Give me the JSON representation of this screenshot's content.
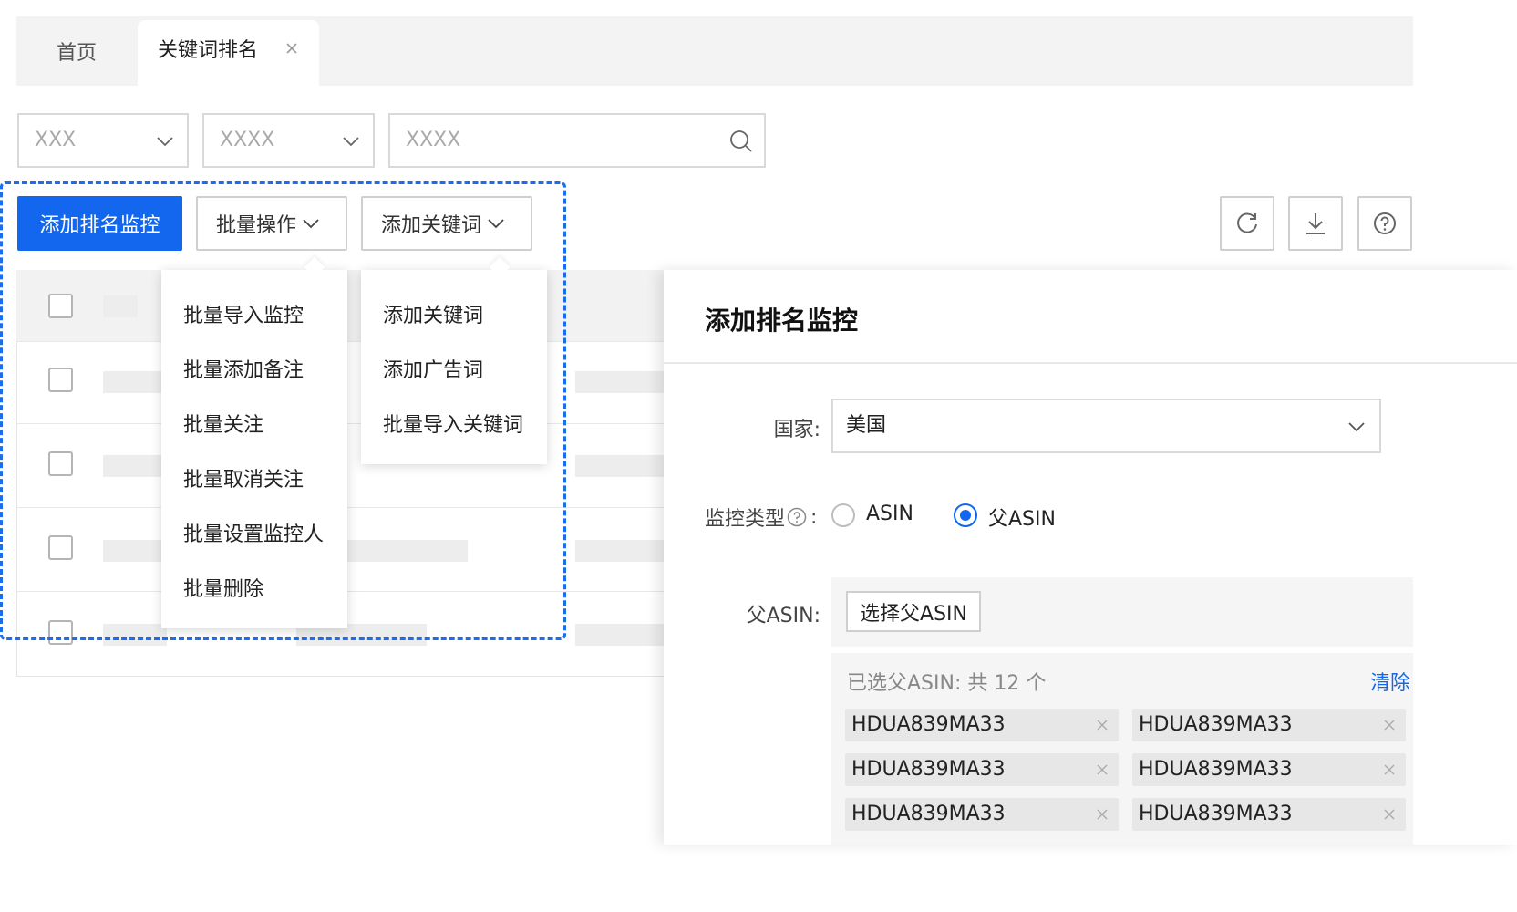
{
  "tabs": {
    "home": "首页",
    "active": "关键词排名"
  },
  "filters": {
    "select1": "XXX",
    "select2": "XXXX",
    "search_placeholder": "XXXX"
  },
  "toolbar": {
    "add_monitor": "添加排名监控",
    "batch_ops": "批量操作",
    "add_keywords": "添加关键词"
  },
  "batch_menu": {
    "items": [
      "批量导入监控",
      "批量添加备注",
      "批量关注",
      "批量取消关注",
      "批量设置监控人",
      "批量删除"
    ]
  },
  "keyword_menu": {
    "items": [
      "添加关键词",
      "添加广告词",
      "批量导入关键词"
    ]
  },
  "drawer": {
    "title": "添加排名监控",
    "country_label": "国家:",
    "country_value": "美国",
    "monitor_type_label": "监控类型",
    "monitor_type_colon": ":",
    "radio_asin": "ASIN",
    "radio_parent_asin": "父ASIN",
    "selected_type": "父ASIN",
    "parent_asin_label": "父ASIN:",
    "select_parent_asin_button": "选择父ASIN",
    "selected_summary": "已选父ASIN: 共 12 个",
    "clear": "清除",
    "tags": [
      "HDUA839MA33",
      "HDUA839MA33",
      "HDUA839MA33",
      "HDUA839MA33",
      "HDUA839MA33",
      "HDUA839MA33"
    ]
  },
  "colors": {
    "primary": "#1366ee",
    "border": "#d9d9d9",
    "placeholder_bg": "#ededed"
  }
}
